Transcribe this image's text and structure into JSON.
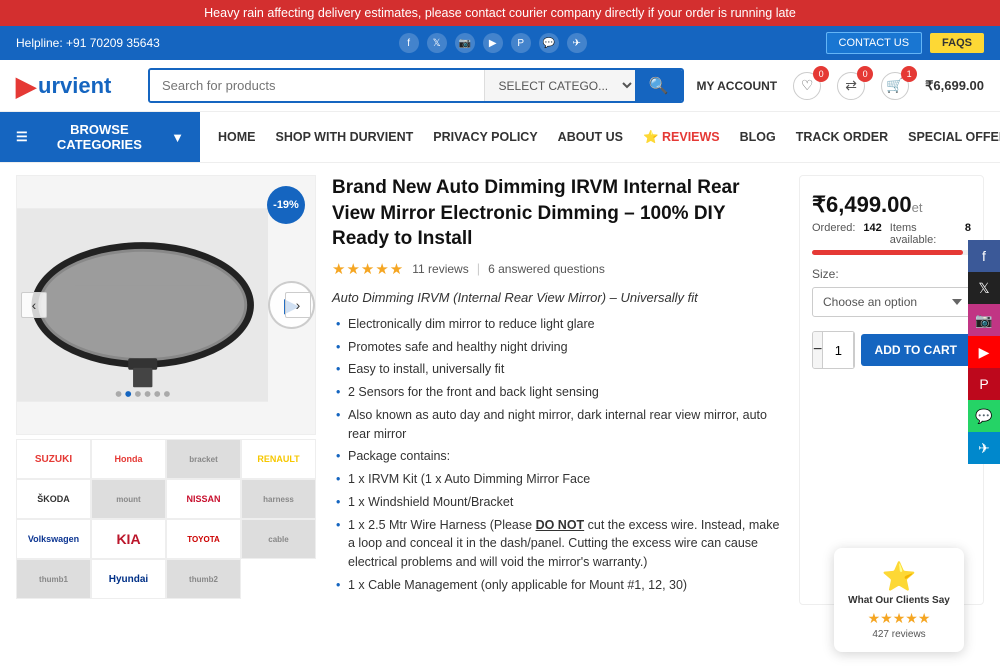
{
  "banner": {
    "text": "Heavy rain affecting delivery estimates, please contact courier company directly if your order is running late"
  },
  "topbar": {
    "helpline": "Helpline: +91 70209 35643",
    "contact_label": "CONTACT US",
    "faq_label": "FAQS"
  },
  "header": {
    "logo_text": "urvient",
    "search_placeholder": "Search for products",
    "category_placeholder": "SELECT CATEGO...",
    "account_label": "MY ACCOUNT",
    "wishlist_count": "0",
    "compare_count": "0",
    "cart_count": "1",
    "cart_price": "₹6,699.00"
  },
  "nav": {
    "browse_label": "BROWSE CATEGORIES",
    "links": [
      {
        "label": "HOME",
        "active": false
      },
      {
        "label": "SHOP WITH DURVIENT",
        "active": false
      },
      {
        "label": "PRIVACY POLICY",
        "active": false
      },
      {
        "label": "ABOUT US",
        "active": false
      },
      {
        "label": "⭐ REVIEWS",
        "active": false
      },
      {
        "label": "BLOG",
        "active": false
      },
      {
        "label": "TRACK ORDER",
        "active": false
      },
      {
        "label": "SPECIAL OFFERS",
        "active": false
      }
    ]
  },
  "product": {
    "title": "Brand New Auto Dimming IRVM Internal Rear View Mirror Electronic Dimming – 100% DIY Ready to Install",
    "rating_stars": "★★★★★",
    "rating_count": "11 reviews",
    "qa_count": "6 answered questions",
    "description": "Auto Dimming IRVM (Internal Rear View Mirror) – Universally fit",
    "bullets": [
      "Electronically dim mirror to reduce light glare",
      "Promotes safe and healthy night driving",
      "Easy to install, universally fit",
      "2 Sensors for the front and back light sensing",
      "Also known as auto day and night mirror, dark internal rear view mirror, auto rear mirror",
      "Package contains:",
      "1 x IRVM Kit (1 x Auto Dimming Mirror Face",
      "1 x Windshield Mount/Bracket",
      "1 x 2.5 Mtr Wire Harness (Please DO NOT cut the excess wire. Instead, make a loop and conceal it in the dash/panel. Cutting the excess wire can cause electrical problems and will void the mirror's warranty.)",
      "1 x Cable Management (only applicable for Mount #1, 12, 30)"
    ],
    "discount": "-19%",
    "price": "₹6,499.00",
    "price_suffix": "et",
    "ordered_label": "Ordered:",
    "ordered_value": "142",
    "available_label": "Items available:",
    "available_value": "8",
    "size_label": "Size:",
    "size_placeholder": "Choose an option",
    "qty_value": "1",
    "add_to_cart_label": "ADD TO CART"
  },
  "social_sidebar": [
    {
      "color": "#3b5998",
      "icon": "f",
      "name": "facebook"
    },
    {
      "color": "#222",
      "icon": "𝕏",
      "name": "twitter-x"
    },
    {
      "color": "#e1306c",
      "icon": "📷",
      "name": "instagram"
    },
    {
      "color": "#ff0000",
      "icon": "▶",
      "name": "youtube"
    },
    {
      "color": "#bd081c",
      "icon": "P",
      "name": "pinterest"
    },
    {
      "color": "#25d366",
      "icon": "💬",
      "name": "whatsapp"
    },
    {
      "color": "#0088cc",
      "icon": "✈",
      "name": "telegram"
    }
  ],
  "reviews_widget": {
    "star_emoji": "⭐",
    "title": "What Our Clients Say",
    "stars": "★★★★★",
    "count": "427 reviews"
  },
  "brands": [
    "SUZUKI",
    "Honda",
    "",
    "RENAULT",
    "ŠKODA",
    "",
    "NISSAN",
    "",
    "VW",
    "KIA",
    "TOYOTA",
    "",
    "",
    "Hyundai",
    ""
  ]
}
